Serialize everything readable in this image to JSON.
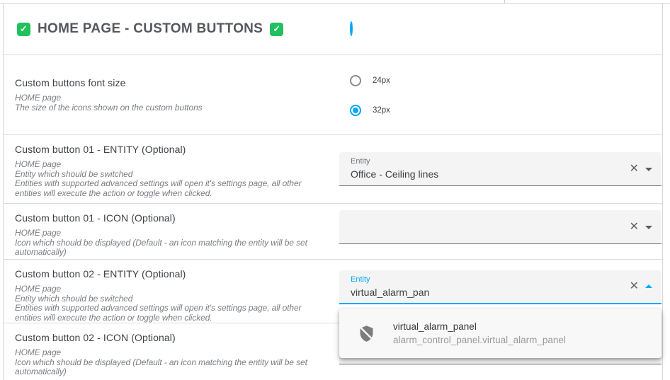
{
  "colors": {
    "accent": "#03a9f4",
    "check_green": "#21c15e"
  },
  "icons": {
    "check_glyph": "✓",
    "clear_glyph": "✕"
  },
  "header": {
    "title": "HOME PAGE - CUSTOM BUTTONS",
    "radio_selected": true
  },
  "fontSize": {
    "title": "Custom buttons font size",
    "subtitle": [
      "HOME page",
      "The size of the icons shown on the custom buttons"
    ],
    "options": [
      {
        "label": "24px",
        "selected": false
      },
      {
        "label": "32px",
        "selected": true
      }
    ]
  },
  "rows": [
    {
      "title": "Custom button 01 - ENTITY (Optional)",
      "subtitle": [
        "HOME page",
        "Entity which should be switched",
        "Entities with supported advanced settings will open it's settings page, all other entities will execute the action or toggle when clicked."
      ],
      "field": {
        "label": "Entity",
        "value": "Office - Ceiling lines"
      }
    },
    {
      "title": "Custom button 01 - ICON (Optional)",
      "subtitle": [
        "HOME page",
        "Icon which should be displayed (Default - an icon matching the entity will be set automatically)"
      ],
      "field": {
        "label": "",
        "value": ""
      }
    },
    {
      "title": "Custom button 02 - ENTITY (Optional)",
      "subtitle": [
        "HOME page",
        "Entity which should be switched",
        "Entities with supported advanced settings will open it's settings page, all other entities will execute the action or toggle when clicked."
      ],
      "field": {
        "label": "Entity",
        "value": "virtual_alarm_pan",
        "active": true
      },
      "dropdown": {
        "item": {
          "icon": "shield-off-icon",
          "primary": "virtual_alarm_panel",
          "secondary": "alarm_control_panel.virtual_alarm_panel"
        }
      }
    },
    {
      "title": "Custom button 02 - ICON (Optional)",
      "subtitle": [
        "HOME page",
        "Icon which should be displayed (Default - an icon matching the entity will be set automatically)"
      ],
      "field": {
        "label": "",
        "value": ""
      }
    }
  ]
}
